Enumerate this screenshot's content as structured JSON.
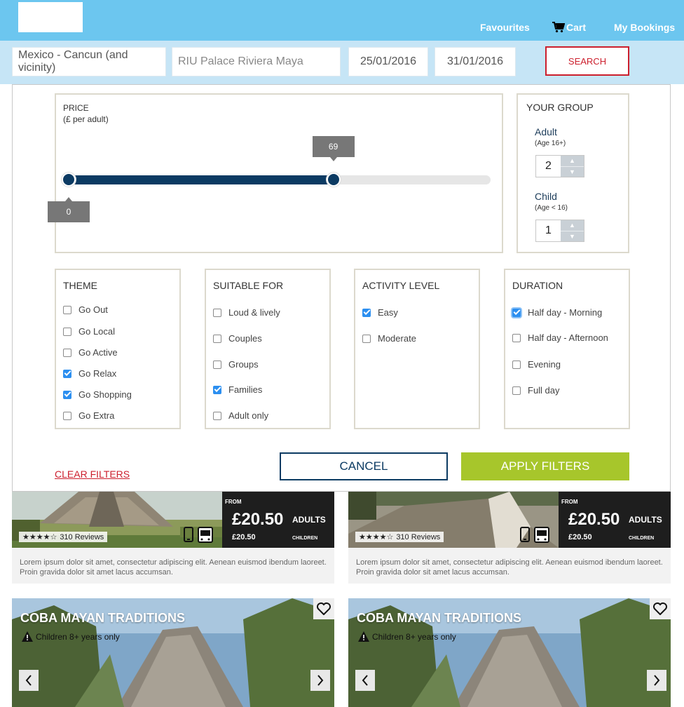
{
  "header": {
    "nav": {
      "favourites": "Favourites",
      "cart": "Cart",
      "bookings": "My Bookings"
    }
  },
  "search": {
    "destination": "Mexico - Cancun (and vicinity)",
    "hotel_placeholder": "RIU Palace Riviera Maya",
    "check_in": "25/01/2016",
    "check_out": "31/01/2016",
    "button": "SEARCH"
  },
  "filters": {
    "price": {
      "title": "PRICE",
      "subtitle": "(£ per adult)",
      "min": "0",
      "max": "69",
      "min_value": 0,
      "max_value": 69,
      "range_max": 110
    },
    "group": {
      "title": "YOUR GROUP",
      "adult_label": "Adult",
      "adult_sub": "(Age 16+)",
      "adult_value": "2",
      "child_label": "Child",
      "child_sub": "(Age < 16)",
      "child_value": "1"
    },
    "theme": {
      "title": "THEME",
      "options": [
        {
          "label": "Go Out",
          "checked": false
        },
        {
          "label": "Go Local",
          "checked": false
        },
        {
          "label": "Go Active",
          "checked": false
        },
        {
          "label": "Go Relax",
          "checked": true
        },
        {
          "label": "Go Shopping",
          "checked": true
        },
        {
          "label": "Go Extra",
          "checked": false
        }
      ]
    },
    "suitable": {
      "title": "SUITABLE FOR",
      "options": [
        {
          "label": "Loud & lively",
          "checked": false
        },
        {
          "label": "Couples",
          "checked": false
        },
        {
          "label": "Groups",
          "checked": false
        },
        {
          "label": "Families",
          "checked": true
        },
        {
          "label": "Adult only",
          "checked": false
        }
      ]
    },
    "activity": {
      "title": "ACTIVITY LEVEL",
      "options": [
        {
          "label": "Easy",
          "checked": true
        },
        {
          "label": "Moderate",
          "checked": false
        }
      ]
    },
    "duration": {
      "title": "DURATION",
      "options": [
        {
          "label": "Half day - Morning",
          "checked": true
        },
        {
          "label": "Half day - Afternoon",
          "checked": false
        },
        {
          "label": "Evening",
          "checked": false
        },
        {
          "label": "Full day",
          "checked": false
        }
      ]
    },
    "clear": "CLEAR FILTERS",
    "cancel": "CANCEL",
    "apply": "APPLY FILTERS"
  },
  "cards": [
    {
      "from": "FROM",
      "price": "£20.50",
      "adults": "ADULTS",
      "child_price": "£20.50",
      "children": "CHILDREN",
      "stars": "★★★★☆",
      "reviews": "310 Reviews",
      "desc": "Lorem ipsum dolor sit amet, consectetur adipiscing elit. Aenean euismod ibendum laoreet. Proin gravida dolor sit amet lacus accumsan."
    },
    {
      "from": "FROM",
      "price": "£20.50",
      "adults": "ADULTS",
      "child_price": "£20.50",
      "children": "CHILDREN",
      "stars": "★★★★☆",
      "reviews": "310 Reviews",
      "desc": "Lorem ipsum dolor sit amet, consectetur adipiscing elit. Aenean euismod ibendum laoreet. Proin gravida dolor sit amet lacus accumsan."
    }
  ],
  "tours": [
    {
      "title": "COBA MAYAN TRADITIONS",
      "note": "Children 8+ years only"
    },
    {
      "title": "COBA MAYAN TRADITIONS",
      "note": "Children 8+ years only"
    }
  ],
  "colors": {
    "header": "#6cc6ef",
    "search_bg": "#c6e5f6",
    "accent_red": "#cc1f2d",
    "navy": "#0c3b63",
    "apply_green": "#a7c62b",
    "checkbox_blue": "#2c8ff0"
  }
}
